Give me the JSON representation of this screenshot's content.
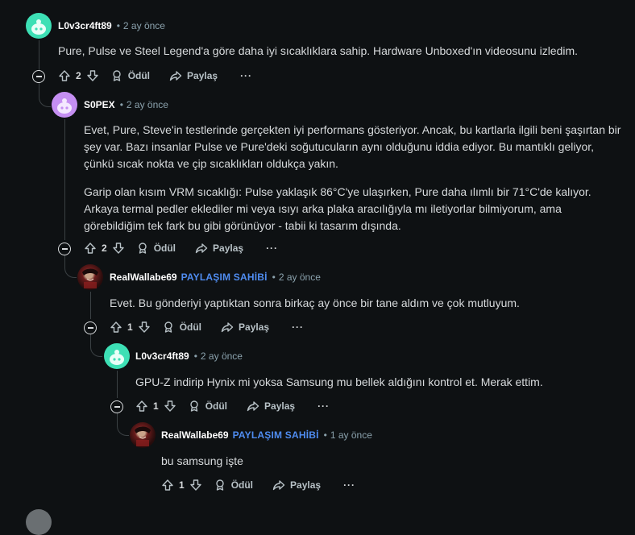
{
  "comments": [
    {
      "user": "L0v3cr4ft89",
      "op": "",
      "time": "2 ay önce",
      "paragraphs": [
        "Pure, Pulse ve Steel Legend'a göre daha iyi sıcaklıklara sahip. Hardware Unboxed'ın videosunu izledim."
      ],
      "votes": "2"
    },
    {
      "user": "S0PEX",
      "op": "",
      "time": "2 ay önce",
      "paragraphs": [
        "Evet, Pure, Steve'in testlerinde gerçekten iyi performans gösteriyor. Ancak, bu kartlarla ilgili beni şaşırtan bir şey var. Bazı insanlar Pulse ve Pure'deki soğutucuların aynı olduğunu iddia ediyor. Bu mantıklı geliyor, çünkü sıcak nokta ve çip sıcaklıkları oldukça yakın.",
        "Garip olan kısım VRM sıcaklığı: Pulse yaklaşık 86°C'ye ulaşırken, Pure daha ılımlı bir 71°C'de kalıyor. Arkaya termal pedler eklediler mi veya ısıyı arka plaka aracılığıyla mı iletiyorlar bilmiyorum, ama görebildiğim tek fark bu gibi görünüyor - tabii ki tasarım dışında."
      ],
      "votes": "2"
    },
    {
      "user": "RealWallabe69",
      "op": "PAYLAŞIM SAHİBİ",
      "time": "2 ay önce",
      "paragraphs": [
        "Evet. Bu gönderiyi yaptıktan sonra birkaç ay önce bir tane aldım ve çok mutluyum."
      ],
      "votes": "1"
    },
    {
      "user": "L0v3cr4ft89",
      "op": "",
      "time": "2 ay önce",
      "paragraphs": [
        "GPU-Z indirip Hynix mi yoksa Samsung mu bellek aldığını kontrol et. Merak ettim."
      ],
      "votes": "1"
    },
    {
      "user": "RealWallabe69",
      "op": "PAYLAŞIM SAHİBİ",
      "time": "1 ay önce",
      "paragraphs": [
        "bu samsung işte"
      ],
      "votes": "1"
    }
  ],
  "actions": {
    "award": "Ödül",
    "share": "Paylaş",
    "more": "···"
  },
  "separator": "•",
  "colors": {
    "background": "#0e1113",
    "op_badge": "#4f8cf0",
    "snoo_teal": "#3de0b5",
    "snoo_purple": "#c58ff2"
  },
  "icons": [
    "upvote-icon",
    "downvote-icon",
    "award-icon",
    "share-icon",
    "collapse-icon",
    "snoo-avatar"
  ]
}
